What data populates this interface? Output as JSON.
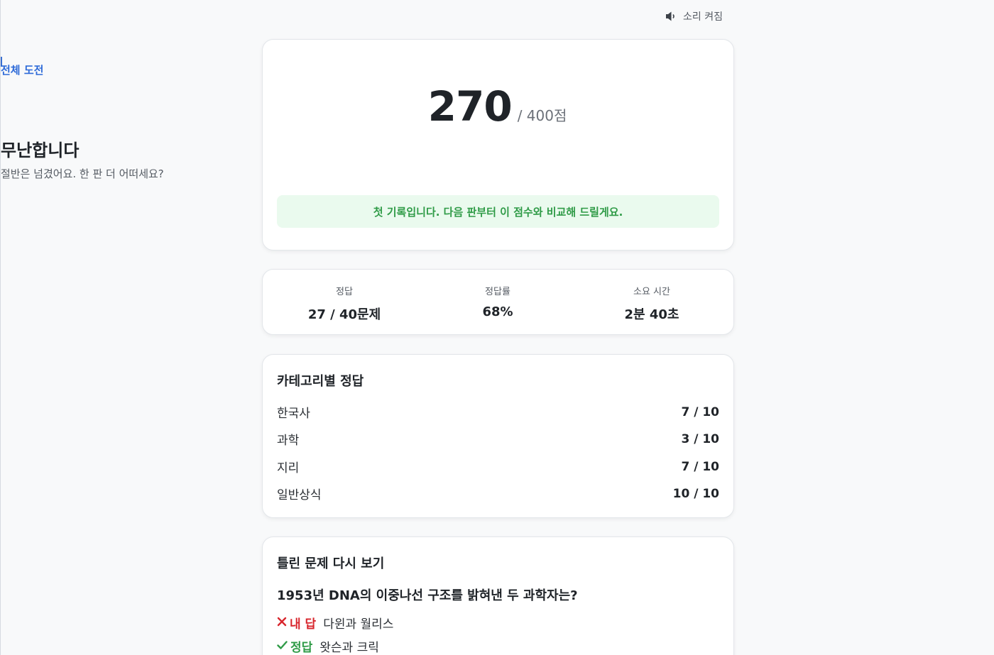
{
  "sound": {
    "icon": "speaker-icon",
    "label": "소리 켜짐"
  },
  "score": {
    "mode": "전체 도전",
    "value": "270",
    "max": "/ 400점",
    "grade": "무난합니다",
    "description": "절반은 넘겼어요. 한 판 더 어떠세요?",
    "record_message": "첫 기록입니다. 다음 판부터 이 점수와 비교해 드릴게요."
  },
  "stats": [
    {
      "label": "정답",
      "value": "27 / 40문제"
    },
    {
      "label": "정답률",
      "value": "68%"
    },
    {
      "label": "소요 시간",
      "value": "2분 40초"
    }
  ],
  "categories": {
    "title": "카테고리별 정답",
    "items": [
      {
        "name": "한국사",
        "score": "7 / 10"
      },
      {
        "name": "과학",
        "score": "3 / 10"
      },
      {
        "name": "지리",
        "score": "7 / 10"
      },
      {
        "name": "일반상식",
        "score": "10 / 10"
      }
    ]
  },
  "review": {
    "title": "틀린 문제 다시 보기",
    "items": [
      {
        "question": "1953년 DNA의 이중나선 구조를 밝혀낸 두 과학자는?",
        "my_answer_label": "내 답",
        "my_answer": "다윈과 월리스",
        "correct_label": "정답",
        "correct_answer": "왓슨과 크릭"
      }
    ]
  },
  "colors": {
    "accent": "#2f6bd8",
    "success": "#2f9b47",
    "success_bg": "#eafaee",
    "error": "#d8262d"
  }
}
